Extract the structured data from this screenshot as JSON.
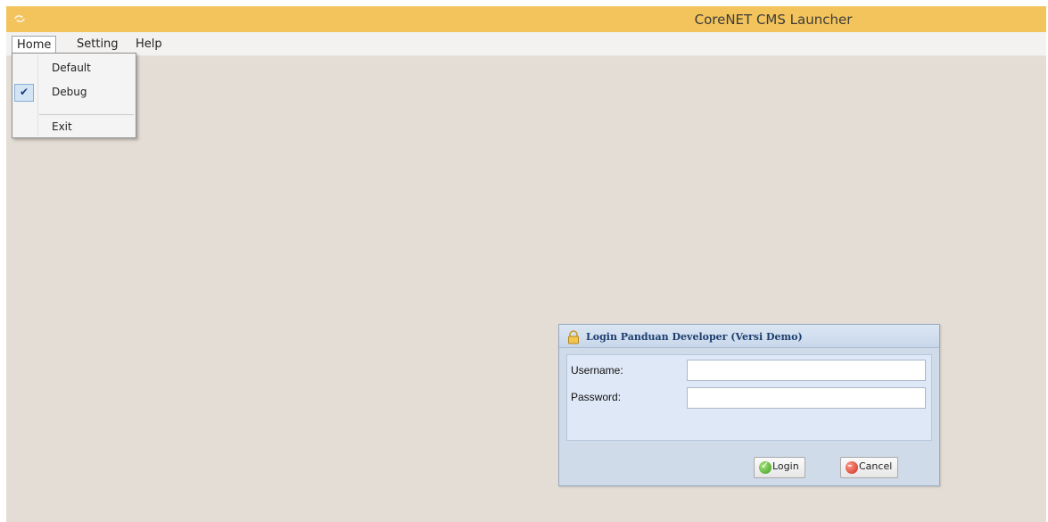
{
  "window": {
    "title": "CoreNET CMS Launcher",
    "icons": {
      "app": "app-logo-icon"
    }
  },
  "menubar": {
    "items": [
      {
        "label": "Home",
        "active": true
      },
      {
        "label": "Setting",
        "active": false
      },
      {
        "label": "Help",
        "active": false
      }
    ]
  },
  "dropdown": {
    "items": [
      {
        "label": "Default",
        "checked": false
      },
      {
        "label": "Debug",
        "checked": true
      },
      {
        "label": "Exit",
        "checked": false
      }
    ],
    "check_glyph": "✔"
  },
  "login": {
    "title": "Login Panduan Developer (Versi Demo)",
    "icon": "lock-icon",
    "username_label": "Username:",
    "password_label": "Password:",
    "username_value": "",
    "password_value": "",
    "login_label": "Login",
    "cancel_label": "Cancel",
    "login_icon": "ok-icon",
    "cancel_icon": "cancel-icon"
  },
  "colors": {
    "titlebar": "#f3c45c",
    "background": "#e3ddd5",
    "panel": "#cfdbe9",
    "panel_title": "#1e3f6f"
  }
}
